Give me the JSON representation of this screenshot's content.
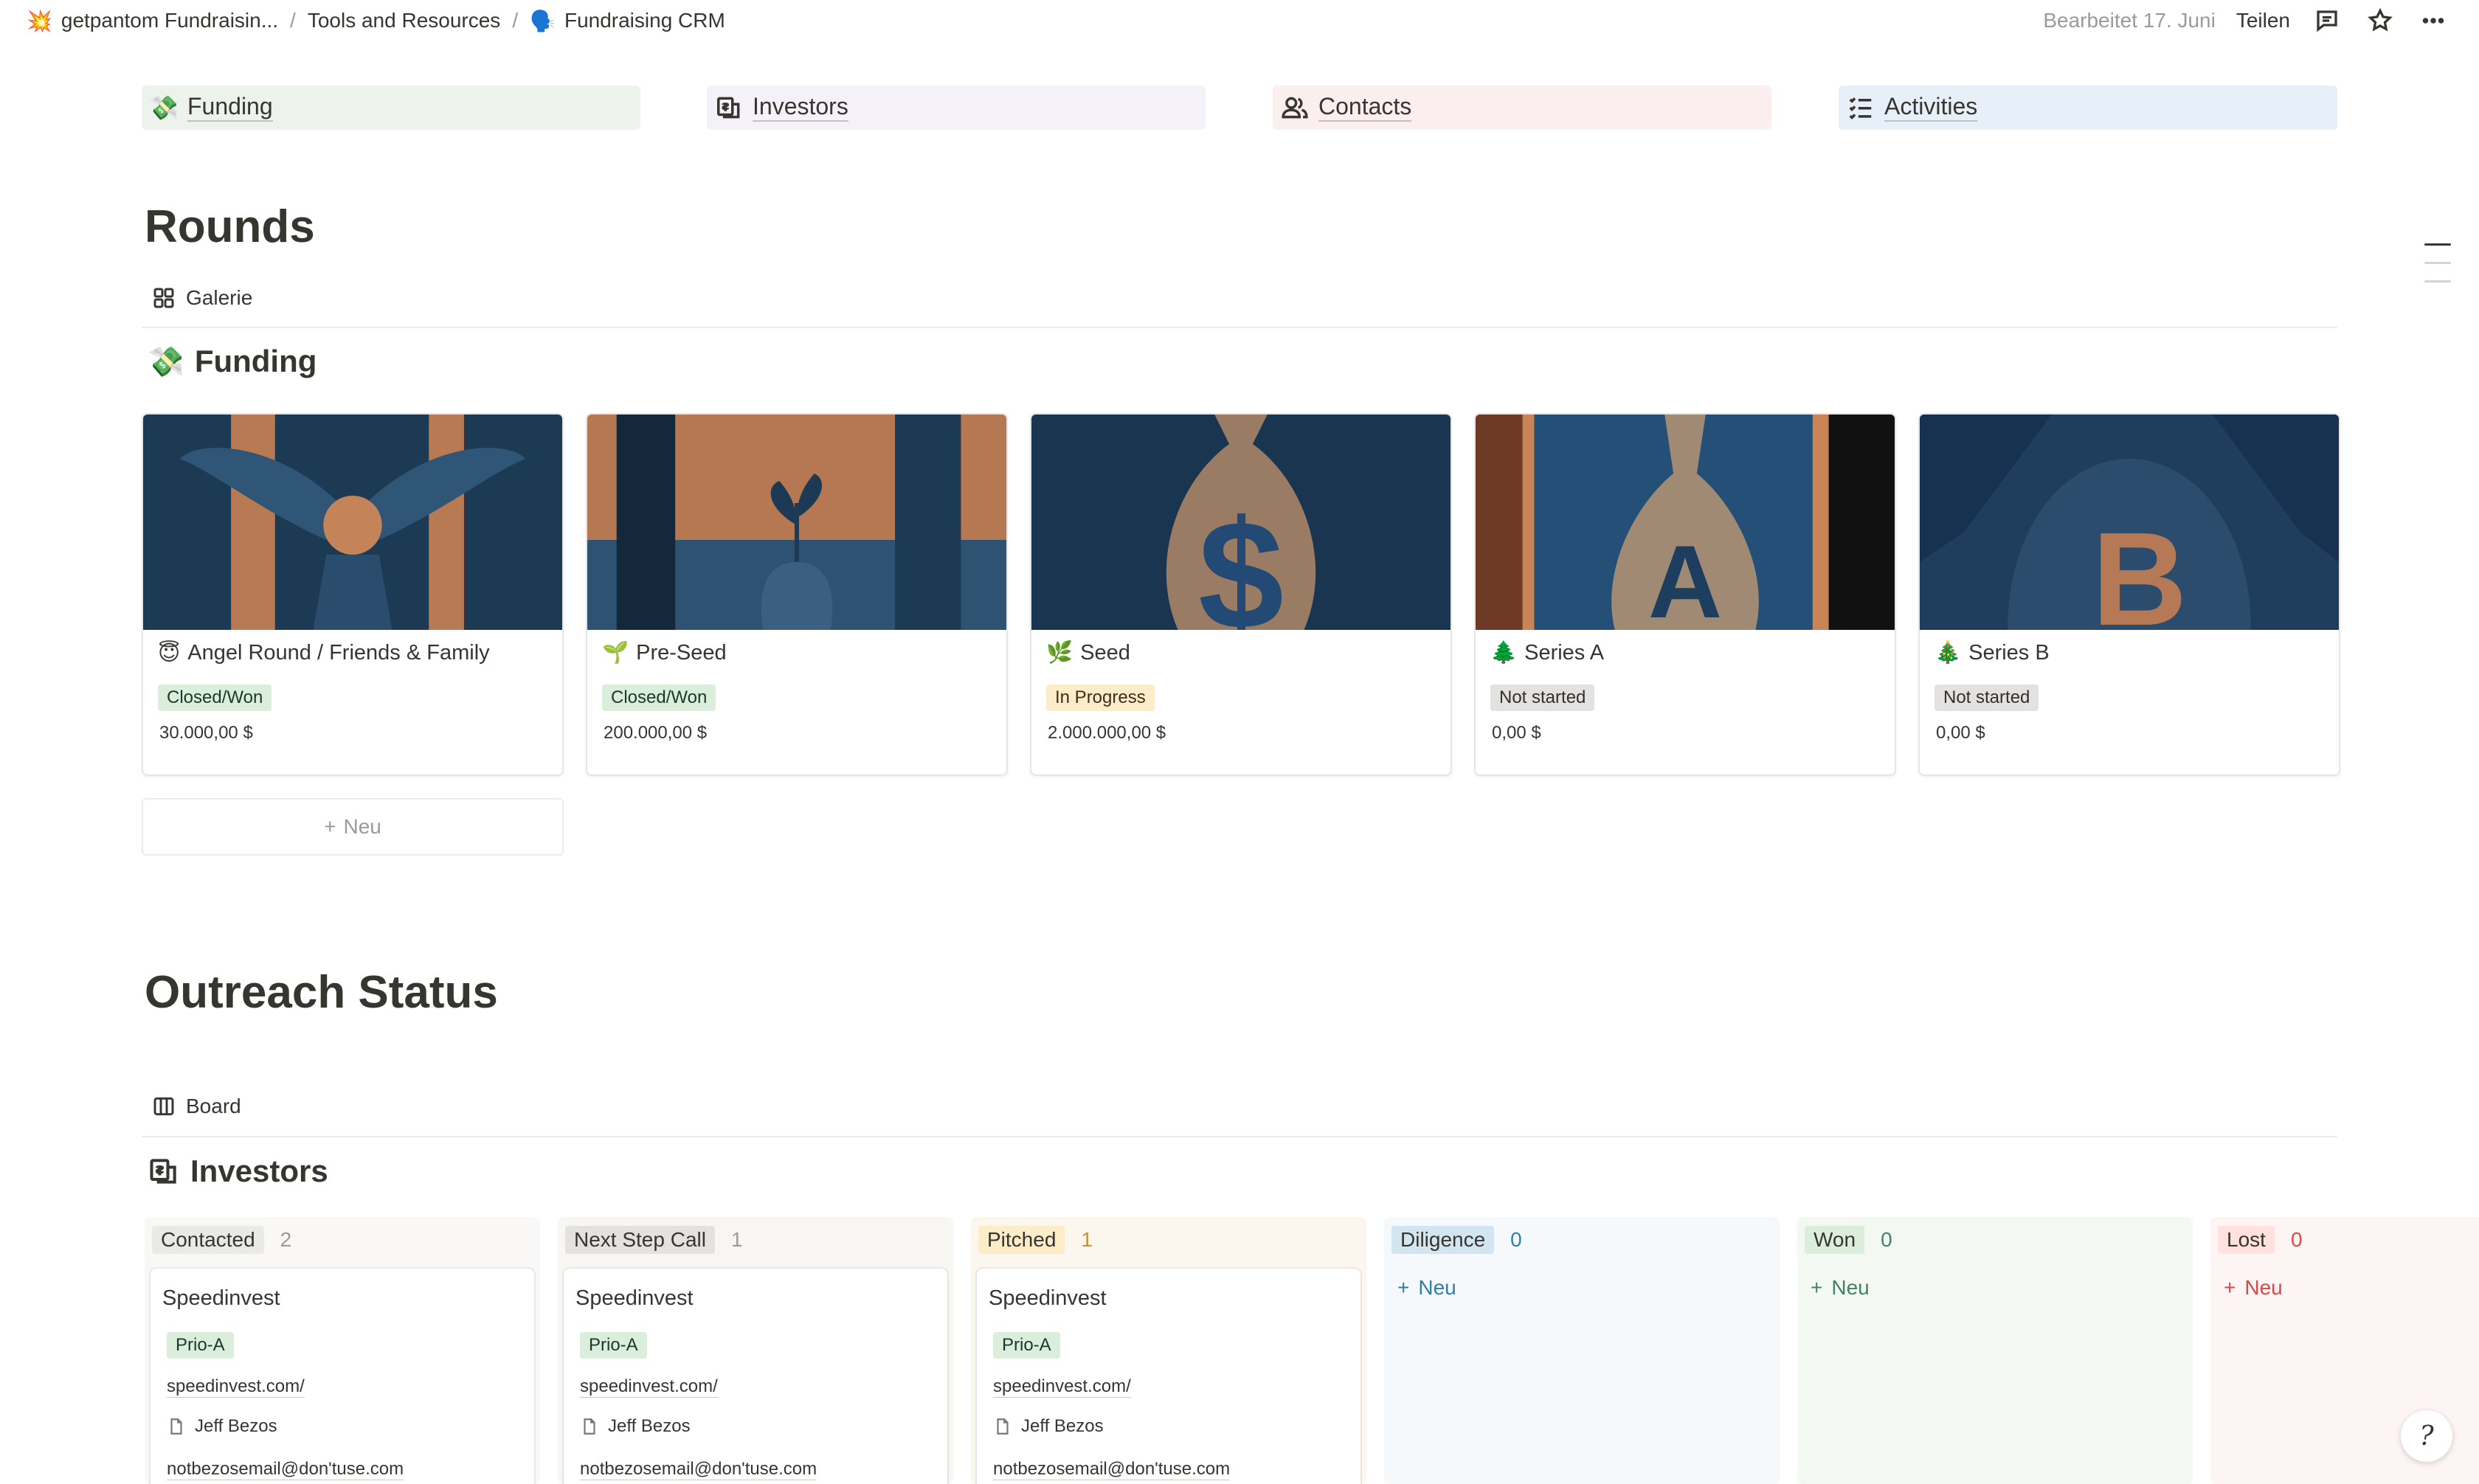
{
  "breadcrumb": {
    "workspace_icon": "💥",
    "workspace": "getpantom Fundraisin...",
    "parent": "Tools and Resources",
    "page_icon": "🗣️",
    "page": "Fundraising CRM",
    "separator": "/"
  },
  "topbar": {
    "edited": "Bearbeitet 17. Juni",
    "share": "Teilen"
  },
  "nav": [
    {
      "label": "Funding",
      "icon": "money-wings-icon",
      "emoji": "💸"
    },
    {
      "label": "Investors",
      "icon": "money-building-icon"
    },
    {
      "label": "Contacts",
      "icon": "people-icon"
    },
    {
      "label": "Activities",
      "icon": "checklist-icon"
    }
  ],
  "rounds": {
    "heading": "Rounds",
    "view": "Galerie",
    "db_icon": "💸",
    "db_title": "Funding",
    "new_label": "Neu",
    "cards": [
      {
        "emoji": "😇",
        "title": "Angel Round / Friends & Family",
        "status": "Closed/Won",
        "amount": "30.000,00 $"
      },
      {
        "emoji": "🌱",
        "title": "Pre-Seed",
        "status": "Closed/Won",
        "amount": "200.000,00 $"
      },
      {
        "emoji": "🌿",
        "title": "Seed",
        "status": "In Progress",
        "amount": "2.000.000,00 $"
      },
      {
        "emoji": "🌲",
        "title": "Series A",
        "status": "Not started",
        "amount": "0,00 $"
      },
      {
        "emoji": "🎄",
        "title": "Series B",
        "status": "Not started",
        "amount": "0,00 $"
      }
    ]
  },
  "outreach": {
    "heading": "Outreach Status",
    "view": "Board",
    "db_title": "Investors",
    "new_label": "Neu",
    "columns": [
      {
        "name": "Contacted",
        "count": "2"
      },
      {
        "name": "Next Step Call",
        "count": "1"
      },
      {
        "name": "Pitched",
        "count": "1"
      },
      {
        "name": "Diligence",
        "count": "0"
      },
      {
        "name": "Won",
        "count": "0"
      },
      {
        "name": "Lost",
        "count": "0"
      }
    ],
    "card": {
      "name": "Speedinvest",
      "priority": "Prio-A",
      "url": "speedinvest.com/",
      "person": "Jeff Bezos",
      "email": "notbezosemail@don'tuse.com"
    }
  },
  "help": "?"
}
